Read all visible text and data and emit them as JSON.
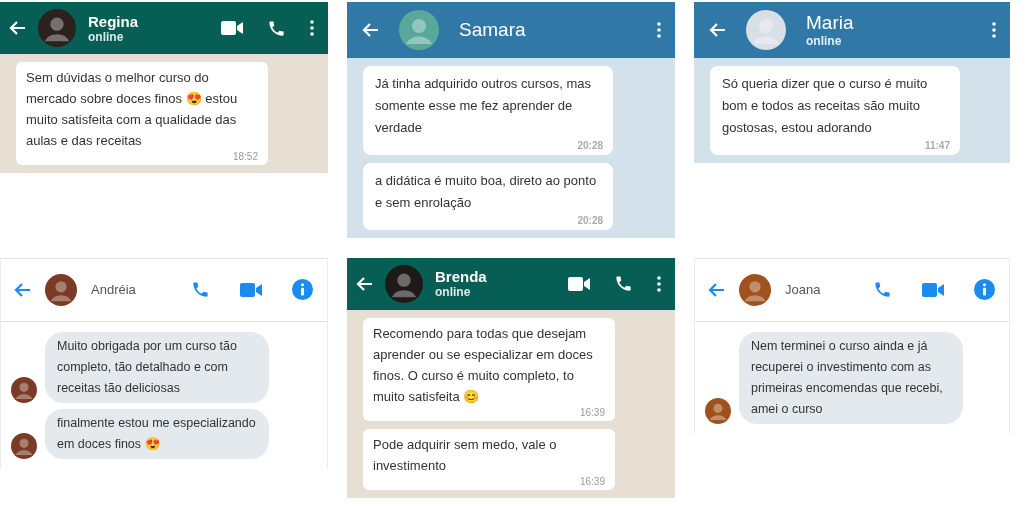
{
  "chats": [
    {
      "kind": "whatsapp",
      "contact": "Regina",
      "status": "online",
      "messages": [
        {
          "text": "Sem dúvidas o melhor curso do mercado sobre doces finos 😍 estou muito satisfeita com a qualidade das aulas e das receitas",
          "time": "18:52"
        }
      ]
    },
    {
      "kind": "telegram",
      "contact": "Samara",
      "messages": [
        {
          "text": "Já tinha adquirido outros cursos, mas somente esse me fez aprender de verdade",
          "time": "20:28"
        },
        {
          "text": "a didática é muito boa, direto ao ponto e sem enrolação",
          "time": "20:28"
        }
      ]
    },
    {
      "kind": "telegram",
      "contact": "Maria",
      "status": "online",
      "messages": [
        {
          "text": "Só queria dizer que o curso é muito bom e todos as receitas são muito gostosas, estou adorando",
          "time": "11:47"
        }
      ]
    },
    {
      "kind": "messenger",
      "contact": "Andréia",
      "messages": [
        {
          "text": "Muito obrigada por um curso tão completo, tão detalhado e com receitas tão deliciosas"
        },
        {
          "text": "finalmente estou me especializando em doces finos 😍"
        }
      ]
    },
    {
      "kind": "whatsapp",
      "contact": "Brenda",
      "status": "online",
      "messages": [
        {
          "text": "Recomendo para todas que desejam aprender ou se especializar em doces finos. O curso é muito completo, to muito satisfeita 😊",
          "time": "16:39"
        },
        {
          "text": "Pode adquirir sem medo, vale o investimento",
          "time": "16:39"
        }
      ]
    },
    {
      "kind": "messenger",
      "contact": "Joana",
      "messages": [
        {
          "text": "Nem terminei o curso ainda e já recuperei o investimento com as primeiras encomendas que recebi, amei o curso"
        }
      ]
    }
  ]
}
